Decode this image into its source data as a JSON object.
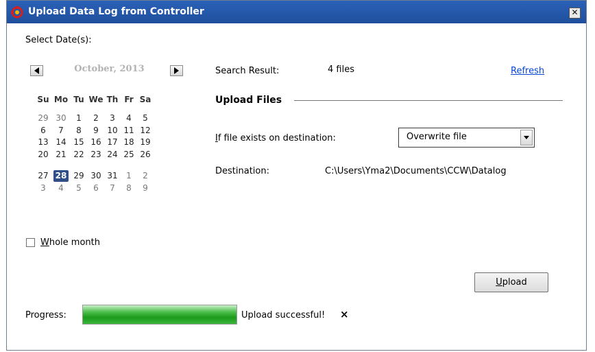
{
  "window": {
    "title": "Upload Data Log from Controller",
    "close_glyph": "✕",
    "icon": "controller-app-icon"
  },
  "calendar": {
    "select_label": "Select Date(s):",
    "month_title": "October, 2013",
    "prev_icon": "left-triangle-icon",
    "next_icon": "right-triangle-icon",
    "weekdays": [
      "Su",
      "Mo",
      "Tu",
      "We",
      "Th",
      "Fr",
      "Sa"
    ],
    "weeks": [
      [
        "29",
        "30",
        "1",
        "2",
        "3",
        "4",
        "5"
      ],
      [
        "6",
        "7",
        "8",
        "9",
        "10",
        "11",
        "12"
      ],
      [
        "13",
        "14",
        "15",
        "16",
        "17",
        "18",
        "19"
      ],
      [
        "20",
        "21",
        "22",
        "23",
        "24",
        "25",
        "26"
      ],
      [
        "27",
        "28",
        "29",
        "30",
        "31",
        "1",
        "2"
      ],
      [
        "3",
        "4",
        "5",
        "6",
        "7",
        "8",
        "9"
      ]
    ],
    "selected_day": "28",
    "whole_month_label_accel": "W",
    "whole_month_label_rest": "hole month",
    "whole_month_checked": false
  },
  "search": {
    "label": "Search Result:",
    "value": "4 files",
    "refresh_label": "Refresh"
  },
  "upload_files": {
    "section_title": "Upload Files",
    "exists_label_accel": "I",
    "exists_label_rest": "f file exists on destination:",
    "exists_option": "Overwrite file",
    "destination_label": "Destination:",
    "destination_value": "C:\\Users\\Yma2\\Documents\\CCW\\Datalog",
    "upload_button_accel": "U",
    "upload_button_rest": "pload"
  },
  "progress": {
    "label": "Progress:",
    "fraction": 1.0,
    "status": "Upload successful!",
    "status_icon": "×"
  },
  "colors": {
    "titlebar": "#2a61b8",
    "selected_day": "#304f87",
    "progress_fill": "#1a9a1a",
    "link": "#0645d6"
  }
}
